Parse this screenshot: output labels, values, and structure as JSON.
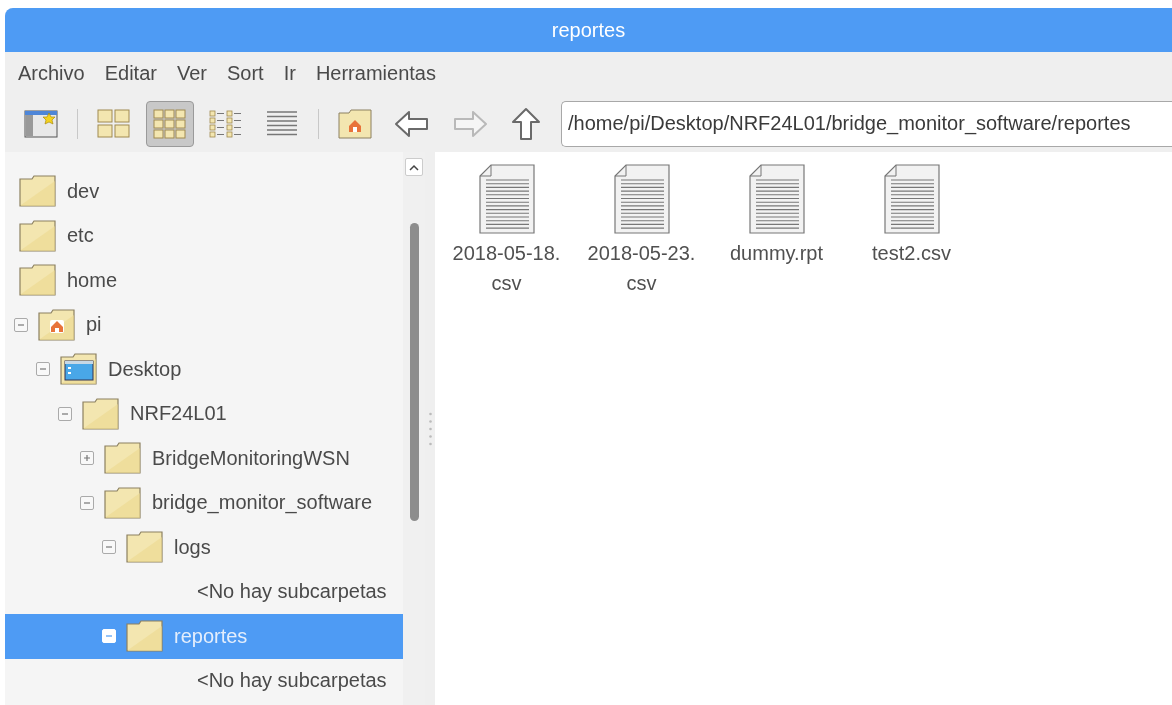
{
  "window": {
    "title": "reportes"
  },
  "menu": [
    "Archivo",
    "Editar",
    "Ver",
    "Sort",
    "Ir",
    "Herramientas"
  ],
  "toolbar": {
    "view_modes": [
      {
        "kind": "thumbnails",
        "selected": false
      },
      {
        "kind": "icons",
        "selected": true
      },
      {
        "kind": "compact",
        "selected": false
      },
      {
        "kind": "list",
        "selected": false
      }
    ],
    "nav": [
      {
        "kind": "home",
        "disabled": false
      },
      {
        "kind": "back",
        "disabled": false
      },
      {
        "kind": "forward",
        "disabled": true
      },
      {
        "kind": "up",
        "disabled": false
      }
    ],
    "path": "/home/pi/Desktop/NRF24L01/bridge_monitor_software/reportes"
  },
  "tree": [
    {
      "label": "dev",
      "kind": "folder",
      "selected": false
    },
    {
      "label": "etc",
      "kind": "folder",
      "selected": false
    },
    {
      "label": "home",
      "kind": "folder",
      "selected": false,
      "children": [
        {
          "label": "pi",
          "kind": "home",
          "selected": false,
          "expanded": true,
          "children": [
            {
              "label": "Desktop",
              "kind": "desktop",
              "selected": false,
              "expanded": true,
              "children": [
                {
                  "label": "NRF24L01",
                  "kind": "folder",
                  "selected": false,
                  "expanded": true,
                  "children": [
                    {
                      "label": "BridgeMonitoringWSN",
                      "kind": "folder",
                      "selected": false,
                      "expanded": false
                    },
                    {
                      "label": "bridge_monitor_software",
                      "kind": "folder",
                      "selected": false,
                      "expanded": true,
                      "children": [
                        {
                          "label": "logs",
                          "kind": "folder",
                          "selected": false,
                          "expanded": true,
                          "children": [
                            {
                              "label": "<No hay subcarpetas",
                              "kind": "placeholder"
                            }
                          ]
                        },
                        {
                          "label": "reportes",
                          "kind": "folder",
                          "selected": true,
                          "expanded": true,
                          "children": [
                            {
                              "label": "<No hay subcarpetas",
                              "kind": "placeholder"
                            }
                          ]
                        }
                      ]
                    }
                  ]
                }
              ]
            }
          ]
        }
      ]
    }
  ],
  "files": [
    {
      "name": "2018-05-18.",
      "name_2": "csv"
    },
    {
      "name": "2018-05-23.",
      "name_2": "csv"
    },
    {
      "name": "dummy.rpt"
    },
    {
      "name": "test2.csv"
    }
  ]
}
